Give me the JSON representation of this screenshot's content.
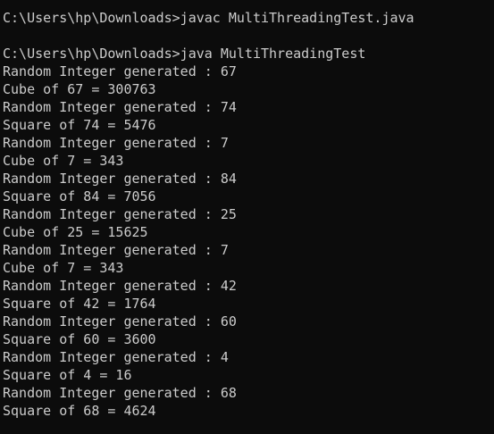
{
  "console": {
    "lines": [
      "C:\\Users\\hp\\Downloads>javac MultiThreadingTest.java",
      "",
      "C:\\Users\\hp\\Downloads>java MultiThreadingTest",
      "Random Integer generated : 67",
      "Cube of 67 = 300763",
      "Random Integer generated : 74",
      "Square of 74 = 5476",
      "Random Integer generated : 7",
      "Cube of 7 = 343",
      "Random Integer generated : 84",
      "Square of 84 = 7056",
      "Random Integer generated : 25",
      "Cube of 25 = 15625",
      "Random Integer generated : 7",
      "Cube of 7 = 343",
      "Random Integer generated : 42",
      "Square of 42 = 1764",
      "Random Integer generated : 60",
      "Square of 60 = 3600",
      "Random Integer generated : 4",
      "Square of 4 = 16",
      "Random Integer generated : 68",
      "Square of 68 = 4624"
    ],
    "colors": {
      "background": "#0c0c0c",
      "text": "#cccccc"
    }
  }
}
